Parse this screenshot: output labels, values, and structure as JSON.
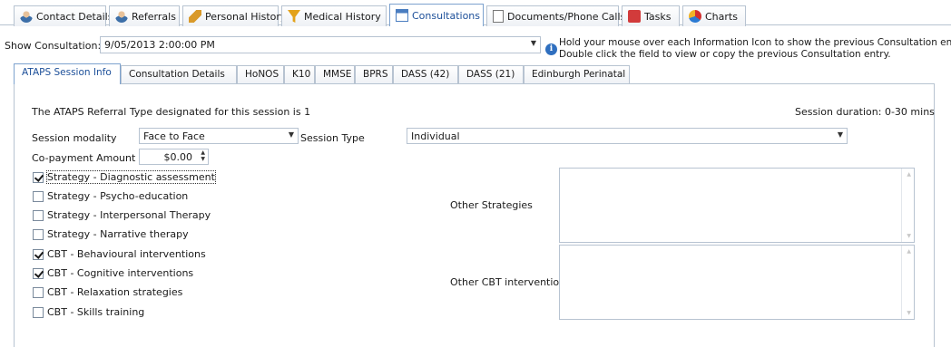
{
  "top_tabs": [
    {
      "label": "Contact Details",
      "icon": "person-icon"
    },
    {
      "label": "Referrals",
      "icon": "person-icon"
    },
    {
      "label": "Personal History",
      "icon": "pen-icon"
    },
    {
      "label": "Medical History",
      "icon": "funnel-icon"
    },
    {
      "label": "Consultations",
      "icon": "calendar-icon"
    },
    {
      "label": "Documents/Phone Calls",
      "icon": "document-icon"
    },
    {
      "label": "Tasks",
      "icon": "tasks-icon"
    },
    {
      "label": "Charts",
      "icon": "chart-icon"
    }
  ],
  "active_top_tab": "Consultations",
  "show_consultation": {
    "label": "Show Consultation:",
    "value": "9/05/2013 2:00:00 PM"
  },
  "info": {
    "line1": "Hold your mouse over each Information Icon to show the previous Consultation entry.",
    "line2": "Double click the field to view or copy the previous Consultation entry."
  },
  "inner_tabs": [
    {
      "label": "ATAPS Session Info"
    },
    {
      "label": "Consultation Details"
    },
    {
      "label": "HoNOS"
    },
    {
      "label": "K10"
    },
    {
      "label": "MMSE"
    },
    {
      "label": "BPRS"
    },
    {
      "label": "DASS (42)"
    },
    {
      "label": "DASS (21)"
    },
    {
      "label": "Edinburgh Perinatal"
    }
  ],
  "active_inner_tab": "ATAPS Session Info",
  "session": {
    "referral_type_text": "The ATAPS Referral Type designated for this session is 1",
    "duration_text": "Session duration: 0-30 mins",
    "modality_label": "Session modality",
    "modality_value": "Face to Face",
    "type_label": "Session Type",
    "type_value": "Individual",
    "copayment_label": "Co-payment Amount",
    "copayment_value": "$0.00"
  },
  "checkboxes": [
    {
      "label": "Strategy - Diagnostic assessment",
      "checked": true
    },
    {
      "label": "Strategy - Psycho-education",
      "checked": false
    },
    {
      "label": "Strategy - Interpersonal Therapy",
      "checked": false
    },
    {
      "label": "Strategy - Narrative therapy",
      "checked": false
    },
    {
      "label": "CBT - Behavioural interventions",
      "checked": true
    },
    {
      "label": "CBT - Cognitive interventions",
      "checked": true
    },
    {
      "label": "CBT - Relaxation strategies",
      "checked": false
    },
    {
      "label": "CBT - Skills training",
      "checked": false
    }
  ],
  "other_strategies": {
    "label": "Other Strategies",
    "value": ""
  },
  "other_cbt": {
    "label": "Other CBT interventions",
    "value": ""
  }
}
